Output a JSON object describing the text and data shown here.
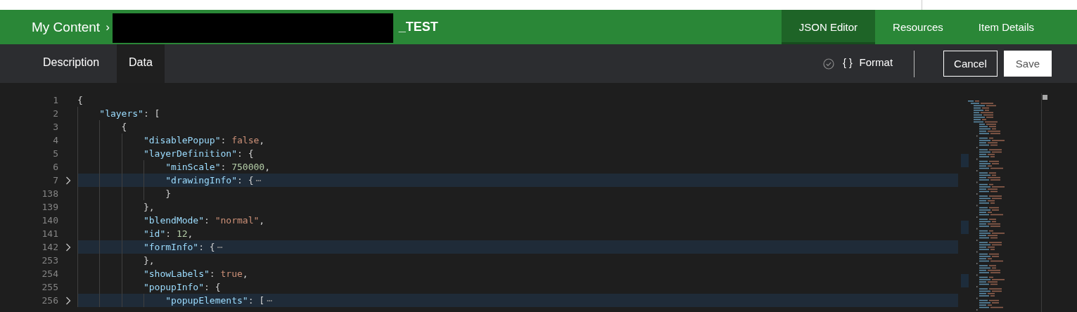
{
  "header": {
    "breadcrumb_root": "My Content",
    "separator": "›",
    "item_title": "_TEST",
    "tabs": [
      {
        "label": "JSON Editor",
        "selected": true
      },
      {
        "label": "Resources",
        "selected": false
      },
      {
        "label": "Item Details",
        "selected": false
      }
    ]
  },
  "subnav": {
    "tabs": [
      {
        "label": "Description",
        "selected": false
      },
      {
        "label": "Data",
        "selected": true
      }
    ],
    "format_button": {
      "icon": "{ }",
      "label": "Format"
    },
    "buttons": [
      {
        "label": "Cancel",
        "kind": "outline"
      },
      {
        "label": "Save",
        "kind": "solid"
      }
    ]
  },
  "editor": {
    "lines": [
      {
        "number": "1",
        "folded": false,
        "highlighted": false,
        "tokens": [
          {
            "kind": "punct",
            "text": "{"
          }
        ]
      },
      {
        "number": "2",
        "folded": false,
        "highlighted": false,
        "tokens": [
          {
            "kind": "key",
            "text": "    \"layers\""
          },
          {
            "kind": "punct",
            "text": ": ["
          }
        ]
      },
      {
        "number": "3",
        "folded": false,
        "highlighted": false,
        "tokens": [
          {
            "kind": "punct",
            "text": "        {"
          }
        ]
      },
      {
        "number": "4",
        "folded": false,
        "highlighted": false,
        "tokens": [
          {
            "kind": "key",
            "text": "            \"disablePopup\""
          },
          {
            "kind": "punct",
            "text": ": "
          },
          {
            "kind": "bool",
            "text": "false"
          },
          {
            "kind": "punct",
            "text": ","
          }
        ]
      },
      {
        "number": "5",
        "folded": false,
        "highlighted": false,
        "tokens": [
          {
            "kind": "key",
            "text": "            \"layerDefinition\""
          },
          {
            "kind": "punct",
            "text": ": {"
          }
        ]
      },
      {
        "number": "6",
        "folded": false,
        "highlighted": false,
        "tokens": [
          {
            "kind": "key",
            "text": "                \"minScale\""
          },
          {
            "kind": "punct",
            "text": ": "
          },
          {
            "kind": "number",
            "text": "750000"
          },
          {
            "kind": "punct",
            "text": ","
          }
        ]
      },
      {
        "number": "7",
        "folded": true,
        "highlighted": true,
        "tokens": [
          {
            "kind": "key",
            "text": "                \"drawingInfo\""
          },
          {
            "kind": "punct",
            "text": ": {"
          },
          {
            "kind": "fold",
            "text": "⋯"
          }
        ]
      },
      {
        "number": "138",
        "folded": false,
        "highlighted": false,
        "tokens": [
          {
            "kind": "punct",
            "text": "                }"
          }
        ]
      },
      {
        "number": "139",
        "folded": false,
        "highlighted": false,
        "tokens": [
          {
            "kind": "punct",
            "text": "            },"
          }
        ]
      },
      {
        "number": "140",
        "folded": false,
        "highlighted": false,
        "tokens": [
          {
            "kind": "key",
            "text": "            \"blendMode\""
          },
          {
            "kind": "punct",
            "text": ": "
          },
          {
            "kind": "string",
            "text": "\"normal\""
          },
          {
            "kind": "punct",
            "text": ","
          }
        ]
      },
      {
        "number": "141",
        "folded": false,
        "highlighted": false,
        "tokens": [
          {
            "kind": "key",
            "text": "            \"id\""
          },
          {
            "kind": "punct",
            "text": ": "
          },
          {
            "kind": "number",
            "text": "12"
          },
          {
            "kind": "punct",
            "text": ","
          }
        ]
      },
      {
        "number": "142",
        "folded": true,
        "highlighted": true,
        "tokens": [
          {
            "kind": "key",
            "text": "            \"formInfo\""
          },
          {
            "kind": "punct",
            "text": ": {"
          },
          {
            "kind": "fold",
            "text": "⋯"
          }
        ]
      },
      {
        "number": "253",
        "folded": false,
        "highlighted": false,
        "tokens": [
          {
            "kind": "punct",
            "text": "            },"
          }
        ]
      },
      {
        "number": "254",
        "folded": false,
        "highlighted": false,
        "tokens": [
          {
            "kind": "key",
            "text": "            \"showLabels\""
          },
          {
            "kind": "punct",
            "text": ": "
          },
          {
            "kind": "bool",
            "text": "true"
          },
          {
            "kind": "punct",
            "text": ","
          }
        ]
      },
      {
        "number": "255",
        "folded": false,
        "highlighted": false,
        "tokens": [
          {
            "kind": "key",
            "text": "            \"popupInfo\""
          },
          {
            "kind": "punct",
            "text": ": {"
          }
        ]
      },
      {
        "number": "256",
        "folded": true,
        "highlighted": true,
        "tokens": [
          {
            "kind": "key",
            "text": "                \"popupElements\""
          },
          {
            "kind": "punct",
            "text": ": ["
          },
          {
            "kind": "fold",
            "text": "⋯"
          }
        ]
      }
    ]
  }
}
